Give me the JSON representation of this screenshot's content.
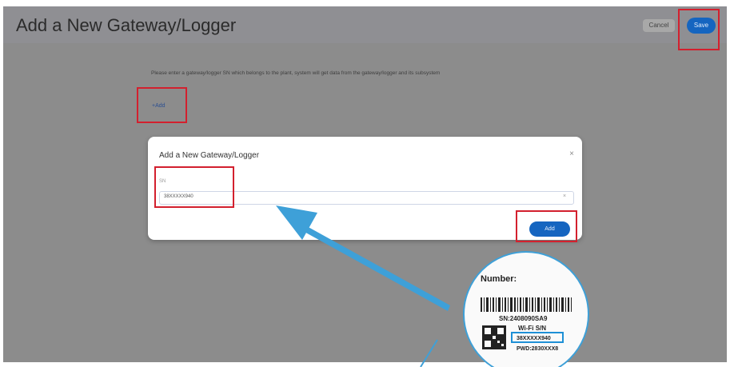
{
  "header": {
    "title": "Add a New Gateway/Logger",
    "cancel_label": "Cancel",
    "save_label": "Save"
  },
  "main": {
    "hint": "Please enter a gateway/logger SN which belongs to the plant, system will get data from the gateway/logger and its subsystem",
    "add_link": "+Add"
  },
  "dialog": {
    "title": "Add a New Gateway/Logger",
    "close_glyph": "×",
    "sn_label": "SN",
    "sn_value": "38XXXXX940",
    "clear_glyph": "×",
    "add_label": "Add"
  },
  "label_callout": {
    "heading": "Number:",
    "sn_line": "SN:2408090SA9",
    "wifi_label": "Wi-Fi S/N",
    "wifi_value": "38XXXXX940",
    "pwd_line": "PWD:2830XXX8"
  },
  "colors": {
    "highlight": "#d3202e",
    "arrow": "#3ea0d8",
    "primary_button": "#1565c0",
    "overlay": "#8c8c8c"
  }
}
